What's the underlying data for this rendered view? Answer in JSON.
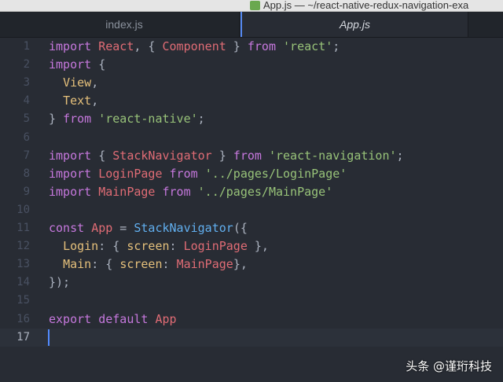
{
  "window": {
    "title": "App.js — ~/react-native-redux-navigation-exa"
  },
  "tabs": [
    {
      "label": "index.js",
      "active": false
    },
    {
      "label": "App.js",
      "active": true
    }
  ],
  "editor": {
    "current_line": 17,
    "line_numbers": [
      "1",
      "2",
      "3",
      "4",
      "5",
      "6",
      "7",
      "8",
      "9",
      "10",
      "11",
      "12",
      "13",
      "14",
      "15",
      "16",
      "17"
    ],
    "lines": [
      [
        [
          "k",
          "import"
        ],
        [
          "p",
          " "
        ],
        [
          "t",
          "React"
        ],
        [
          "p",
          ", { "
        ],
        [
          "t",
          "Component"
        ],
        [
          "p",
          " } "
        ],
        [
          "k",
          "from"
        ],
        [
          "p",
          " "
        ],
        [
          "s",
          "'react'"
        ],
        [
          "p",
          ";"
        ]
      ],
      [
        [
          "k",
          "import"
        ],
        [
          "p",
          " {"
        ]
      ],
      [
        [
          "p",
          "  "
        ],
        [
          "y",
          "View"
        ],
        [
          "p",
          ","
        ]
      ],
      [
        [
          "p",
          "  "
        ],
        [
          "y",
          "Text"
        ],
        [
          "p",
          ","
        ]
      ],
      [
        [
          "p",
          "} "
        ],
        [
          "k",
          "from"
        ],
        [
          "p",
          " "
        ],
        [
          "s",
          "'react-native'"
        ],
        [
          "p",
          ";"
        ]
      ],
      [],
      [
        [
          "k",
          "import"
        ],
        [
          "p",
          " { "
        ],
        [
          "t",
          "StackNavigator"
        ],
        [
          "p",
          " } "
        ],
        [
          "k",
          "from"
        ],
        [
          "p",
          " "
        ],
        [
          "s",
          "'react-navigation'"
        ],
        [
          "p",
          ";"
        ]
      ],
      [
        [
          "k",
          "import"
        ],
        [
          "p",
          " "
        ],
        [
          "t",
          "LoginPage"
        ],
        [
          "p",
          " "
        ],
        [
          "k",
          "from"
        ],
        [
          "p",
          " "
        ],
        [
          "s",
          "'../pages/LoginPage'"
        ]
      ],
      [
        [
          "k",
          "import"
        ],
        [
          "p",
          " "
        ],
        [
          "t",
          "MainPage"
        ],
        [
          "p",
          " "
        ],
        [
          "k",
          "from"
        ],
        [
          "p",
          " "
        ],
        [
          "s",
          "'../pages/MainPage'"
        ]
      ],
      [],
      [
        [
          "k",
          "const"
        ],
        [
          "p",
          " "
        ],
        [
          "t",
          "App"
        ],
        [
          "p",
          " = "
        ],
        [
          "f",
          "StackNavigator"
        ],
        [
          "p",
          "({"
        ]
      ],
      [
        [
          "p",
          "  "
        ],
        [
          "y",
          "Login"
        ],
        [
          "p",
          ": { "
        ],
        [
          "y",
          "screen"
        ],
        [
          "p",
          ": "
        ],
        [
          "t",
          "LoginPage"
        ],
        [
          "p",
          " },"
        ]
      ],
      [
        [
          "p",
          "  "
        ],
        [
          "y",
          "Main"
        ],
        [
          "p",
          ": { "
        ],
        [
          "y",
          "screen"
        ],
        [
          "p",
          ": "
        ],
        [
          "t",
          "MainPage"
        ],
        [
          "p",
          "},"
        ]
      ],
      [
        [
          "p",
          "});"
        ]
      ],
      [],
      [
        [
          "k",
          "export"
        ],
        [
          "p",
          " "
        ],
        [
          "k",
          "default"
        ],
        [
          "p",
          " "
        ],
        [
          "t",
          "App"
        ]
      ],
      []
    ]
  },
  "watermark": "头条 @谨珩科技",
  "colors": {
    "background": "#282c34",
    "keyword": "#c678dd",
    "identifier": "#e06c75",
    "string": "#98c379",
    "property": "#e5c07b",
    "function": "#61afef",
    "punctuation": "#abb2bf",
    "cursor": "#528bff"
  }
}
